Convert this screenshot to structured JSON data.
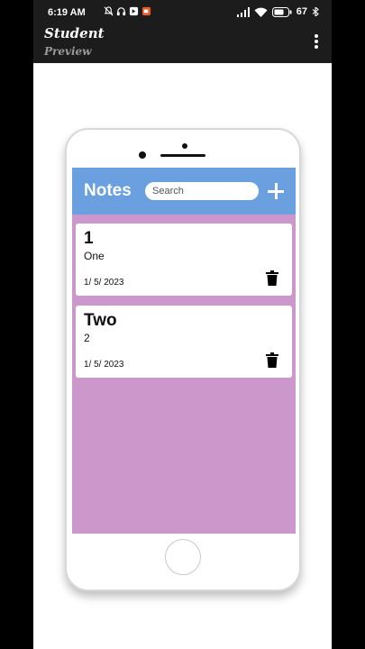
{
  "status_bar": {
    "time": "6:19 AM",
    "battery": "67"
  },
  "app_bar": {
    "title": "Student",
    "subtitle": "Preview"
  },
  "notes_app": {
    "header_title": "Notes",
    "search_placeholder": "Search",
    "colors": {
      "header": "#6a9fe0",
      "background": "#cc98cc"
    },
    "notes": [
      {
        "title": "1",
        "body": "One",
        "date": "1/ 5/ 2023"
      },
      {
        "title": "Two",
        "body": "2",
        "date": "1/ 5/ 2023"
      }
    ]
  }
}
